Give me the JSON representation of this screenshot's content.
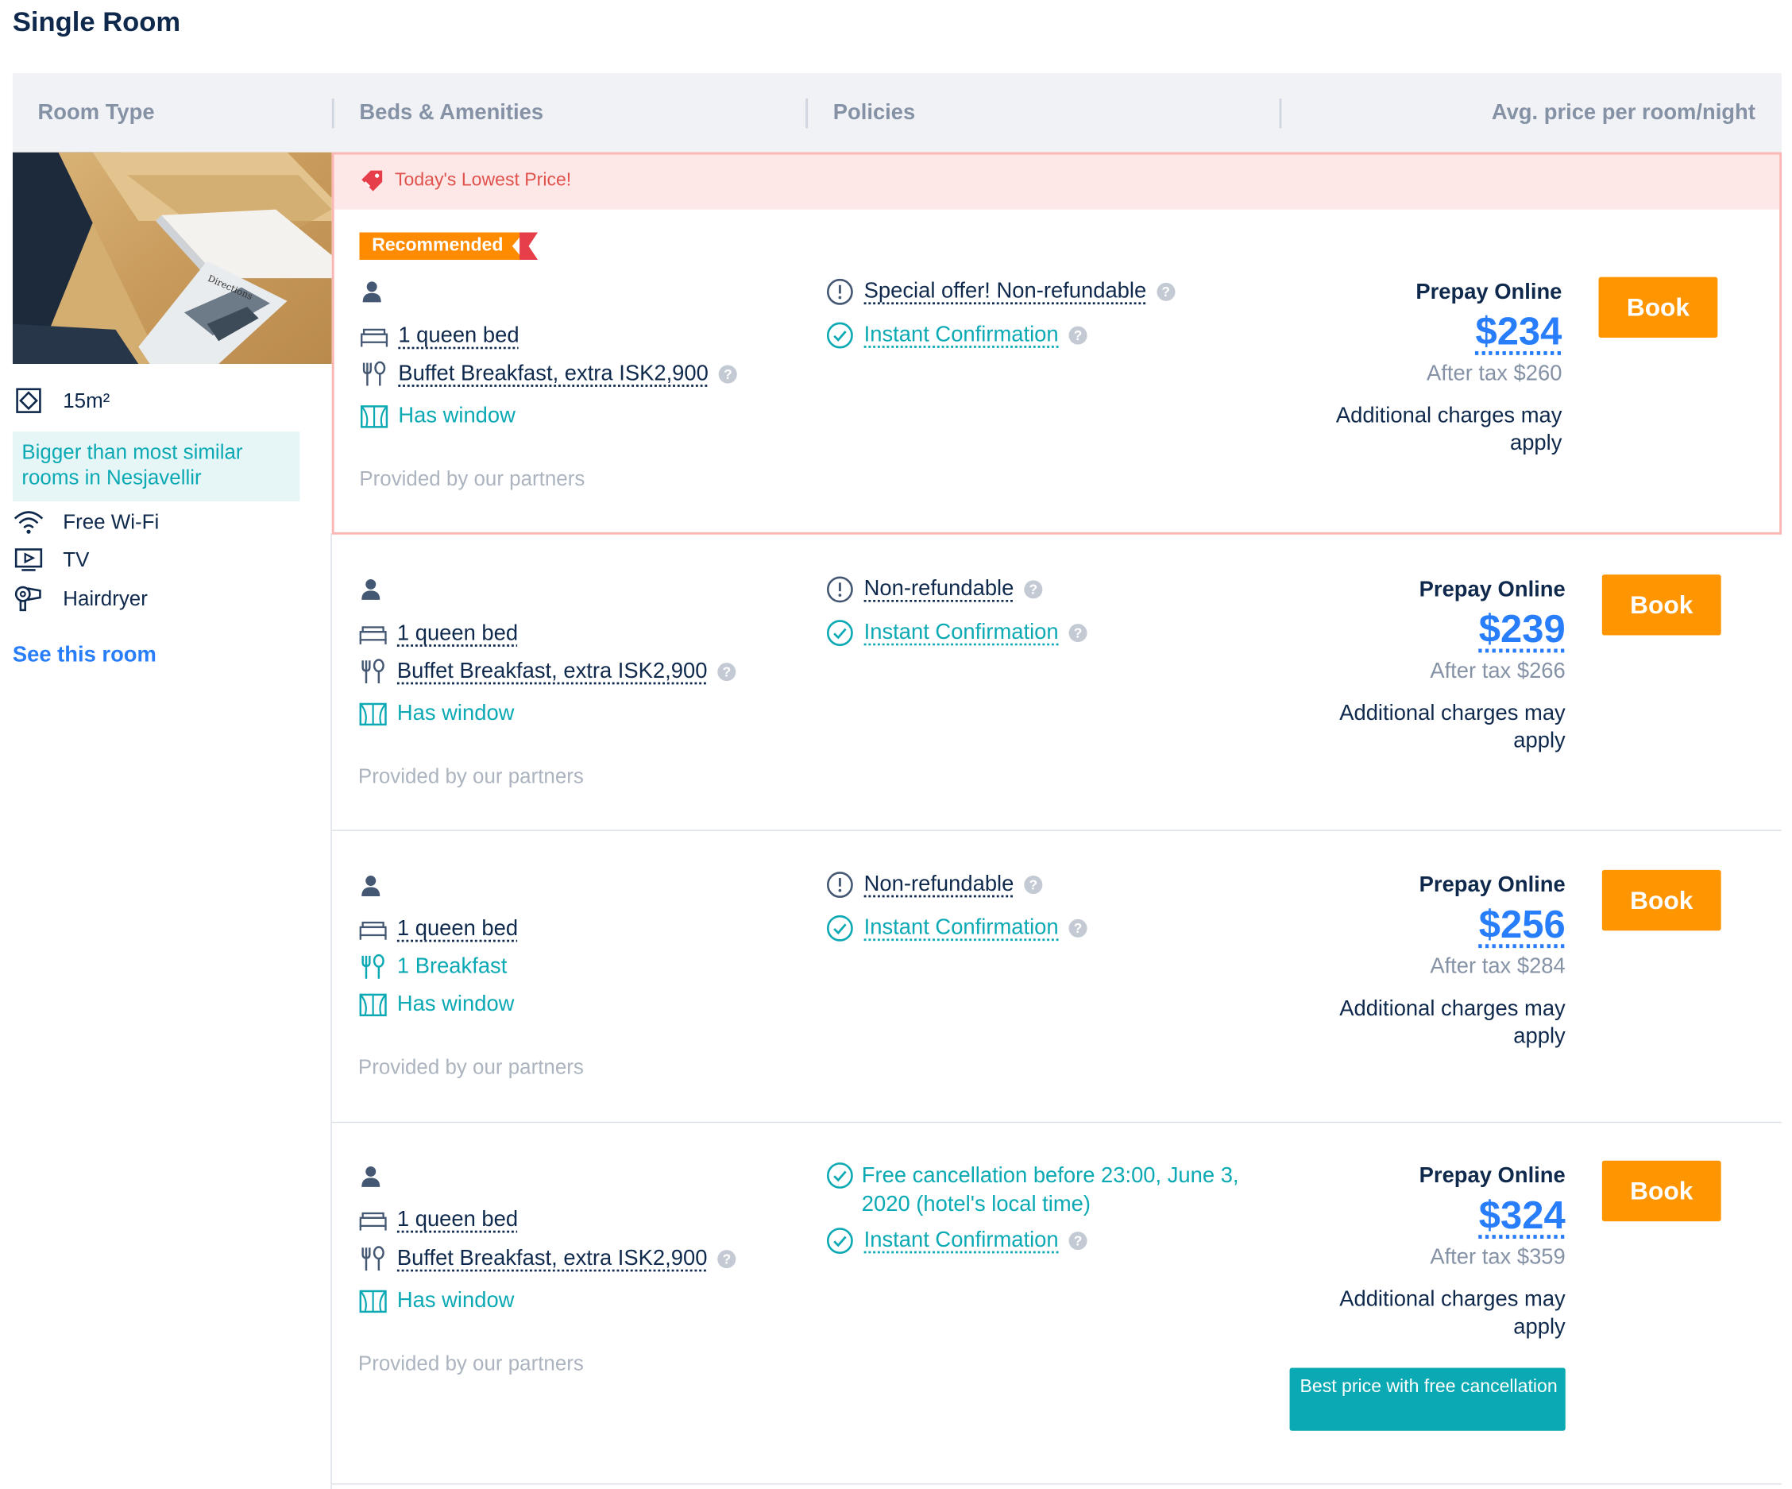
{
  "section_title": "Single Room",
  "table_headers": {
    "room_type": "Room Type",
    "beds": "Beds & Amenities",
    "policies": "Policies",
    "price": "Avg. price per room/night"
  },
  "room": {
    "size": "15m²",
    "bigger_note": "Bigger than most similar rooms in Nesjavellir",
    "features": [
      "Free Wi-Fi",
      "TV",
      "Hairdryer"
    ],
    "see_room": "See this room"
  },
  "lowest_price_label": "Today's Lowest Price!",
  "recommended_label": "Recommended",
  "partners_text": "Provided by our partners",
  "rows": [
    {
      "bed": "1 queen bed",
      "meal": "Buffet Breakfast, extra ISK2,900",
      "window": "Has window",
      "policy1": "Special offer! Non-refundable",
      "policy2": "Instant Confirmation",
      "prepay": "Prepay Online",
      "price": "$234",
      "after_tax": "After tax $260",
      "additional": "Additional charges may apply",
      "book": "Book"
    },
    {
      "bed": "1 queen bed",
      "meal": "Buffet Breakfast, extra ISK2,900",
      "window": "Has window",
      "policy1": "Non-refundable",
      "policy2": "Instant Confirmation",
      "prepay": "Prepay Online",
      "price": "$239",
      "after_tax": "After tax $266",
      "additional": "Additional charges may apply",
      "book": "Book"
    },
    {
      "bed": "1 queen bed",
      "meal": "1 Breakfast",
      "window": "Has window",
      "policy1": "Non-refundable",
      "policy2": "Instant Confirmation",
      "prepay": "Prepay Online",
      "price": "$256",
      "after_tax": "After tax $284",
      "additional": "Additional charges may apply",
      "book": "Book"
    },
    {
      "bed": "1 queen bed",
      "meal": "Buffet Breakfast, extra ISK2,900",
      "window": "Has window",
      "policy1": "Free cancellation before 23:00, June 3, 2020 (hotel's local time)",
      "policy2": "Instant Confirmation",
      "prepay": "Prepay Online",
      "price": "$324",
      "after_tax": "After tax $359",
      "additional": "Additional charges may apply",
      "book": "Book",
      "best_price_badge": "Best price with free cancellation"
    }
  ],
  "colors": {
    "accent_blue": "#287dfa",
    "teal": "#0aa9b4",
    "book_orange": "#ff9500",
    "lowest_red": "#e0524d"
  }
}
